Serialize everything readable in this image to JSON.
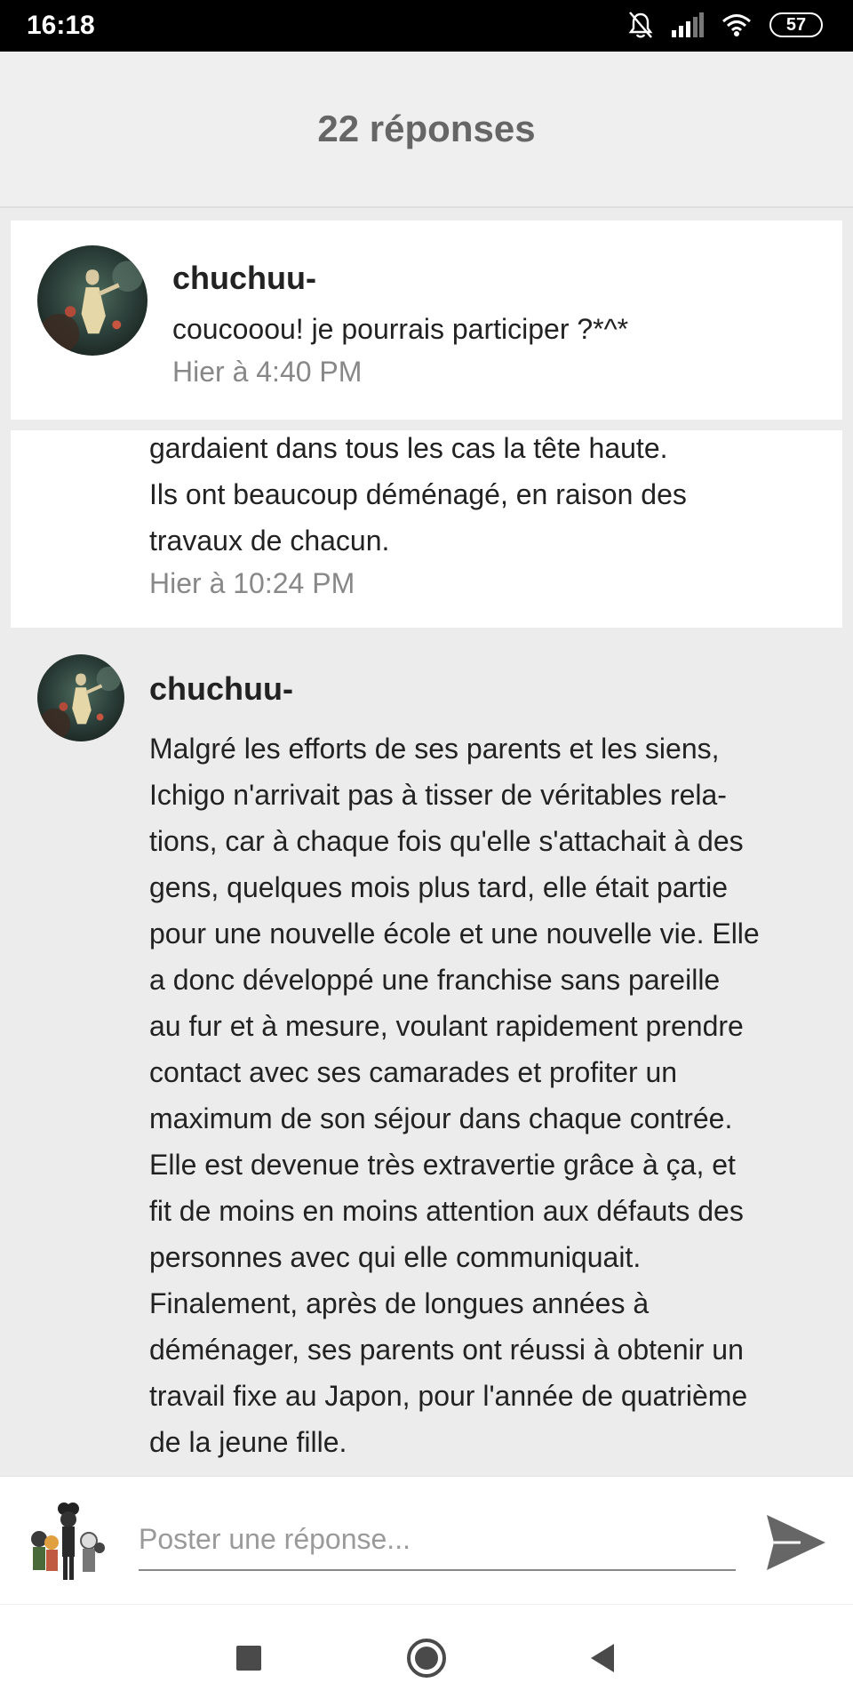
{
  "status_bar": {
    "time": "16:18",
    "battery": "57"
  },
  "header": {
    "title": "22 réponses"
  },
  "posts": [
    {
      "author": "chuchuu-",
      "message": "coucooou! je pourrais participer ?*^*",
      "time": "Hier à 4:40 PM"
    },
    {
      "lines": [
        "gardaient dans tous les cas la tête haute.",
        "Ils ont beaucoup déménagé, en raison des",
        "travaux de chacun."
      ],
      "time": "Hier à 10:24 PM"
    },
    {
      "author": "chuchuu-",
      "lines": [
        "Malgré les efforts de ses parents et les siens,",
        "Ichigo n'arrivait pas à tisser de véritables rela-",
        "tions, car à chaque fois qu'elle s'attachait à des",
        "gens, quelques mois plus tard, elle était partie",
        "pour une nouvelle école et une nouvelle vie. Elle",
        "a donc développé une franchise sans pareille",
        "au fur et à mesure, voulant rapidement prendre",
        "contact avec ses camarades et profiter un",
        "maximum de son séjour dans chaque contrée.",
        "Elle est devenue très extravertie grâce à ça, et",
        "fit de moins en moins attention aux défauts des",
        "personnes avec qui elle communiquait.",
        "Finalement, après de longues années à",
        "déménager, ses parents ont réussi à obtenir un",
        "travail fixe au Japon, pour l'année de quatrième",
        "de la jeune fille."
      ]
    }
  ],
  "composer": {
    "placeholder": "Poster une réponse..."
  },
  "icons": {
    "status": [
      "mute-bell-icon",
      "signal-icon",
      "wifi-icon",
      "battery-icon"
    ],
    "send": "send-icon",
    "nav": [
      "recents-square-icon",
      "home-circle-icon",
      "back-triangle-icon"
    ]
  },
  "colors": {
    "header_bg": "#efefef",
    "page_bg": "#ececec",
    "card_bg": "#ffffff",
    "timestamp": "#888888"
  }
}
